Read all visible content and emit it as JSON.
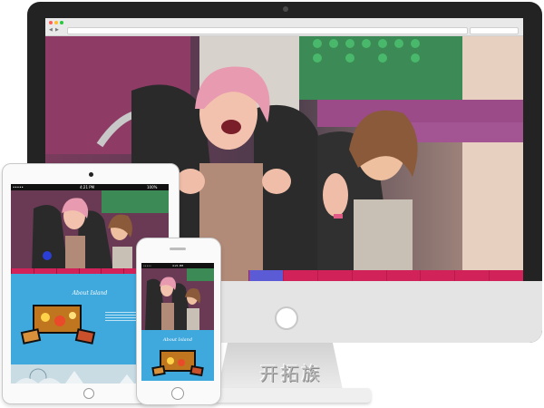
{
  "desktop": {
    "browser_dots": [
      "#ff5f57",
      "#febc2e",
      "#28c840"
    ],
    "nav_items": [
      "",
      "",
      "",
      "",
      "",
      "",
      "",
      ""
    ]
  },
  "brand_watermark": "开拓族",
  "tablet": {
    "status_carrier": "••••• ",
    "status_time": "4:21 PM",
    "status_battery": "100%",
    "about_title": "About Island",
    "about_subtitle": "",
    "nav_items": [
      "",
      "",
      "",
      "",
      "",
      "",
      ""
    ]
  },
  "phone": {
    "status_carrier": "•••••",
    "status_time": "4:21 PM",
    "about_title": "About Island"
  },
  "colors": {
    "nav_pink": "#d2225a",
    "nav_active": "#5b5bd6",
    "about_blue": "#3fa9de"
  }
}
